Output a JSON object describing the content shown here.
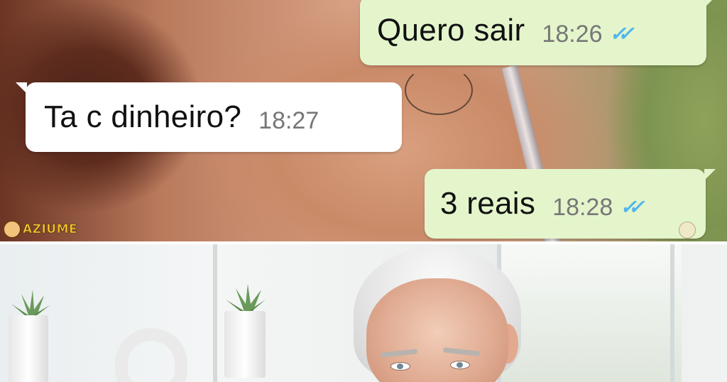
{
  "chat": {
    "messages": [
      {
        "direction": "outgoing",
        "text": "Quero sair",
        "time": "18:26",
        "status": "read"
      },
      {
        "direction": "incoming",
        "text": "Ta c dinheiro?",
        "time": "18:27"
      },
      {
        "direction": "outgoing",
        "text": "3 reais",
        "time": "18:28",
        "status": "read"
      }
    ],
    "read_tick_glyph": "✓✓",
    "colors": {
      "outgoing_bubble": "#e4f5cc",
      "incoming_bubble": "#ffffff",
      "read_ticks": "#4fb6ec",
      "timestamp": "#777777"
    }
  },
  "watermark": {
    "text": "AZIUME"
  }
}
